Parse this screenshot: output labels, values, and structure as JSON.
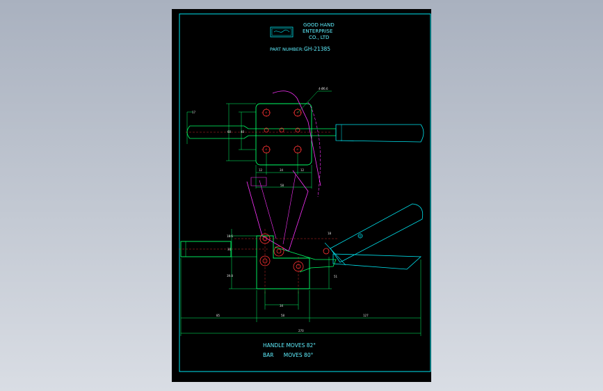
{
  "company": {
    "line1": "GOOD HAND",
    "line2": "ENTERPRISE",
    "line3": "CO., LTD"
  },
  "part": {
    "label": "PART NUMBER:",
    "number": "GH-21385"
  },
  "notes": {
    "handle": "HANDLE MOVES 82°",
    "bar": "BAR      MOVES 80°"
  },
  "dimensions": {
    "hole_spec": "4-Ø6.6",
    "left_17": "17",
    "h_60": "60",
    "h_40": "40",
    "w_12_left": "12",
    "w_34": "34",
    "w_12_right": "12",
    "w_58": "58",
    "side_186": "18.6",
    "side_30": "30",
    "side_398": "39.8",
    "right_51": "51",
    "base_34": "34",
    "bottom_85": "85",
    "bottom_58": "58",
    "bottom_127": "127",
    "total_270": "270",
    "angle_18": "18"
  },
  "colors": {
    "frame": "#00e5f0",
    "outline": "#00ff66",
    "construction": "#ff33ff",
    "center": "#ff3333",
    "text": "#5ff0ff",
    "dim_text": "#e6e6e6"
  }
}
